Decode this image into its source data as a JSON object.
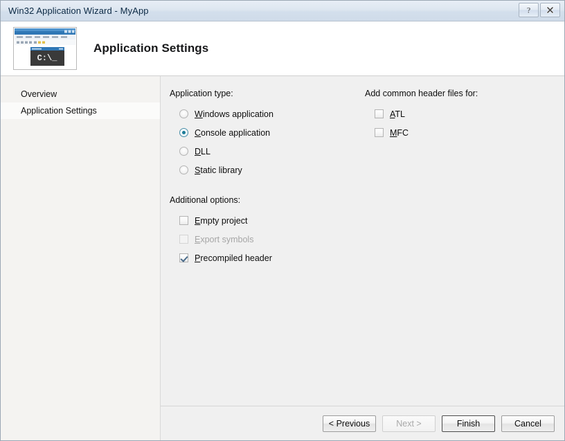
{
  "window": {
    "title": "Win32 Application Wizard - MyApp",
    "help_button": "?",
    "close_button": "×"
  },
  "header": {
    "title": "Application Settings",
    "icon_name": "console-app-thumbnail",
    "console_text": "C:\\_"
  },
  "nav": {
    "items": [
      {
        "label": "Overview",
        "selected": false
      },
      {
        "label": "Application Settings",
        "selected": true
      }
    ]
  },
  "main": {
    "application_type": {
      "label": "Application type:",
      "options": [
        {
          "label": "Windows application",
          "accel": "W",
          "rest": "indows application",
          "checked": false
        },
        {
          "label": "Console application",
          "accel": "C",
          "rest": "onsole application",
          "checked": true
        },
        {
          "label": "DLL",
          "accel": "D",
          "rest": "LL",
          "checked": false
        },
        {
          "label": "Static library",
          "accel": "S",
          "rest": "tatic library",
          "checked": false
        }
      ]
    },
    "additional_options": {
      "label": "Additional options:",
      "options": [
        {
          "label": "Empty project",
          "accel": "E",
          "rest": "mpty project",
          "checked": false,
          "disabled": false
        },
        {
          "label": "Export symbols",
          "accel": "E",
          "rest": "xport symbols",
          "checked": false,
          "disabled": true
        },
        {
          "label": "Precompiled header",
          "accel": "P",
          "rest": "recompiled header",
          "checked": true,
          "disabled": false
        }
      ]
    },
    "common_headers": {
      "label": "Add common header files for:",
      "options": [
        {
          "label": "ATL",
          "accel": "A",
          "rest": "TL",
          "checked": false,
          "disabled": false
        },
        {
          "label": "MFC",
          "accel": "M",
          "rest": "FC",
          "checked": false,
          "disabled": false
        }
      ]
    }
  },
  "footer": {
    "previous": "< Previous",
    "next": "Next >",
    "finish": "Finish",
    "cancel": "Cancel"
  },
  "colors": {
    "accent": "#1b7b98",
    "titlebar": "#dde6f0",
    "content_bg": "#f0f0f0",
    "nav_bg": "#f4f3f1"
  }
}
